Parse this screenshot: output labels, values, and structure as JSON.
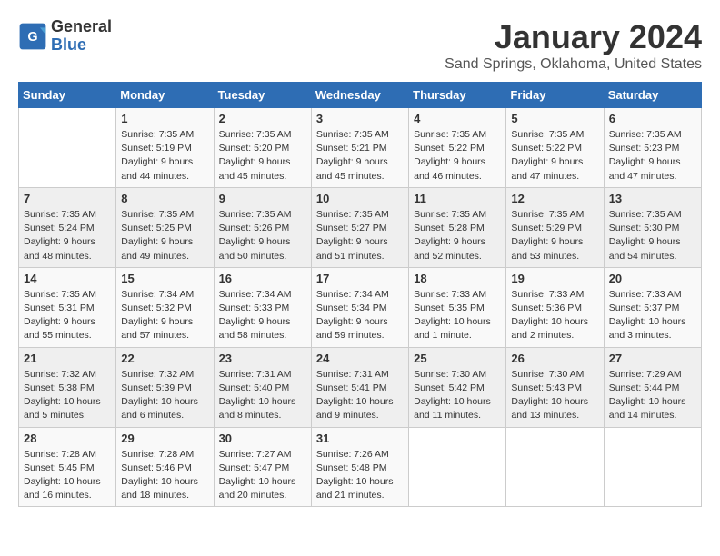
{
  "header": {
    "logo_line1": "General",
    "logo_line2": "Blue",
    "title": "January 2024",
    "location": "Sand Springs, Oklahoma, United States"
  },
  "weekdays": [
    "Sunday",
    "Monday",
    "Tuesday",
    "Wednesday",
    "Thursday",
    "Friday",
    "Saturday"
  ],
  "weeks": [
    [
      {
        "day": "",
        "sunrise": "",
        "sunset": "",
        "daylight": ""
      },
      {
        "day": "1",
        "sunrise": "Sunrise: 7:35 AM",
        "sunset": "Sunset: 5:19 PM",
        "daylight": "Daylight: 9 hours and 44 minutes."
      },
      {
        "day": "2",
        "sunrise": "Sunrise: 7:35 AM",
        "sunset": "Sunset: 5:20 PM",
        "daylight": "Daylight: 9 hours and 45 minutes."
      },
      {
        "day": "3",
        "sunrise": "Sunrise: 7:35 AM",
        "sunset": "Sunset: 5:21 PM",
        "daylight": "Daylight: 9 hours and 45 minutes."
      },
      {
        "day": "4",
        "sunrise": "Sunrise: 7:35 AM",
        "sunset": "Sunset: 5:22 PM",
        "daylight": "Daylight: 9 hours and 46 minutes."
      },
      {
        "day": "5",
        "sunrise": "Sunrise: 7:35 AM",
        "sunset": "Sunset: 5:22 PM",
        "daylight": "Daylight: 9 hours and 47 minutes."
      },
      {
        "day": "6",
        "sunrise": "Sunrise: 7:35 AM",
        "sunset": "Sunset: 5:23 PM",
        "daylight": "Daylight: 9 hours and 47 minutes."
      }
    ],
    [
      {
        "day": "7",
        "sunrise": "Sunrise: 7:35 AM",
        "sunset": "Sunset: 5:24 PM",
        "daylight": "Daylight: 9 hours and 48 minutes."
      },
      {
        "day": "8",
        "sunrise": "Sunrise: 7:35 AM",
        "sunset": "Sunset: 5:25 PM",
        "daylight": "Daylight: 9 hours and 49 minutes."
      },
      {
        "day": "9",
        "sunrise": "Sunrise: 7:35 AM",
        "sunset": "Sunset: 5:26 PM",
        "daylight": "Daylight: 9 hours and 50 minutes."
      },
      {
        "day": "10",
        "sunrise": "Sunrise: 7:35 AM",
        "sunset": "Sunset: 5:27 PM",
        "daylight": "Daylight: 9 hours and 51 minutes."
      },
      {
        "day": "11",
        "sunrise": "Sunrise: 7:35 AM",
        "sunset": "Sunset: 5:28 PM",
        "daylight": "Daylight: 9 hours and 52 minutes."
      },
      {
        "day": "12",
        "sunrise": "Sunrise: 7:35 AM",
        "sunset": "Sunset: 5:29 PM",
        "daylight": "Daylight: 9 hours and 53 minutes."
      },
      {
        "day": "13",
        "sunrise": "Sunrise: 7:35 AM",
        "sunset": "Sunset: 5:30 PM",
        "daylight": "Daylight: 9 hours and 54 minutes."
      }
    ],
    [
      {
        "day": "14",
        "sunrise": "Sunrise: 7:35 AM",
        "sunset": "Sunset: 5:31 PM",
        "daylight": "Daylight: 9 hours and 55 minutes."
      },
      {
        "day": "15",
        "sunrise": "Sunrise: 7:34 AM",
        "sunset": "Sunset: 5:32 PM",
        "daylight": "Daylight: 9 hours and 57 minutes."
      },
      {
        "day": "16",
        "sunrise": "Sunrise: 7:34 AM",
        "sunset": "Sunset: 5:33 PM",
        "daylight": "Daylight: 9 hours and 58 minutes."
      },
      {
        "day": "17",
        "sunrise": "Sunrise: 7:34 AM",
        "sunset": "Sunset: 5:34 PM",
        "daylight": "Daylight: 9 hours and 59 minutes."
      },
      {
        "day": "18",
        "sunrise": "Sunrise: 7:33 AM",
        "sunset": "Sunset: 5:35 PM",
        "daylight": "Daylight: 10 hours and 1 minute."
      },
      {
        "day": "19",
        "sunrise": "Sunrise: 7:33 AM",
        "sunset": "Sunset: 5:36 PM",
        "daylight": "Daylight: 10 hours and 2 minutes."
      },
      {
        "day": "20",
        "sunrise": "Sunrise: 7:33 AM",
        "sunset": "Sunset: 5:37 PM",
        "daylight": "Daylight: 10 hours and 3 minutes."
      }
    ],
    [
      {
        "day": "21",
        "sunrise": "Sunrise: 7:32 AM",
        "sunset": "Sunset: 5:38 PM",
        "daylight": "Daylight: 10 hours and 5 minutes."
      },
      {
        "day": "22",
        "sunrise": "Sunrise: 7:32 AM",
        "sunset": "Sunset: 5:39 PM",
        "daylight": "Daylight: 10 hours and 6 minutes."
      },
      {
        "day": "23",
        "sunrise": "Sunrise: 7:31 AM",
        "sunset": "Sunset: 5:40 PM",
        "daylight": "Daylight: 10 hours and 8 minutes."
      },
      {
        "day": "24",
        "sunrise": "Sunrise: 7:31 AM",
        "sunset": "Sunset: 5:41 PM",
        "daylight": "Daylight: 10 hours and 9 minutes."
      },
      {
        "day": "25",
        "sunrise": "Sunrise: 7:30 AM",
        "sunset": "Sunset: 5:42 PM",
        "daylight": "Daylight: 10 hours and 11 minutes."
      },
      {
        "day": "26",
        "sunrise": "Sunrise: 7:30 AM",
        "sunset": "Sunset: 5:43 PM",
        "daylight": "Daylight: 10 hours and 13 minutes."
      },
      {
        "day": "27",
        "sunrise": "Sunrise: 7:29 AM",
        "sunset": "Sunset: 5:44 PM",
        "daylight": "Daylight: 10 hours and 14 minutes."
      }
    ],
    [
      {
        "day": "28",
        "sunrise": "Sunrise: 7:28 AM",
        "sunset": "Sunset: 5:45 PM",
        "daylight": "Daylight: 10 hours and 16 minutes."
      },
      {
        "day": "29",
        "sunrise": "Sunrise: 7:28 AM",
        "sunset": "Sunset: 5:46 PM",
        "daylight": "Daylight: 10 hours and 18 minutes."
      },
      {
        "day": "30",
        "sunrise": "Sunrise: 7:27 AM",
        "sunset": "Sunset: 5:47 PM",
        "daylight": "Daylight: 10 hours and 20 minutes."
      },
      {
        "day": "31",
        "sunrise": "Sunrise: 7:26 AM",
        "sunset": "Sunset: 5:48 PM",
        "daylight": "Daylight: 10 hours and 21 minutes."
      },
      {
        "day": "",
        "sunrise": "",
        "sunset": "",
        "daylight": ""
      },
      {
        "day": "",
        "sunrise": "",
        "sunset": "",
        "daylight": ""
      },
      {
        "day": "",
        "sunrise": "",
        "sunset": "",
        "daylight": ""
      }
    ]
  ]
}
